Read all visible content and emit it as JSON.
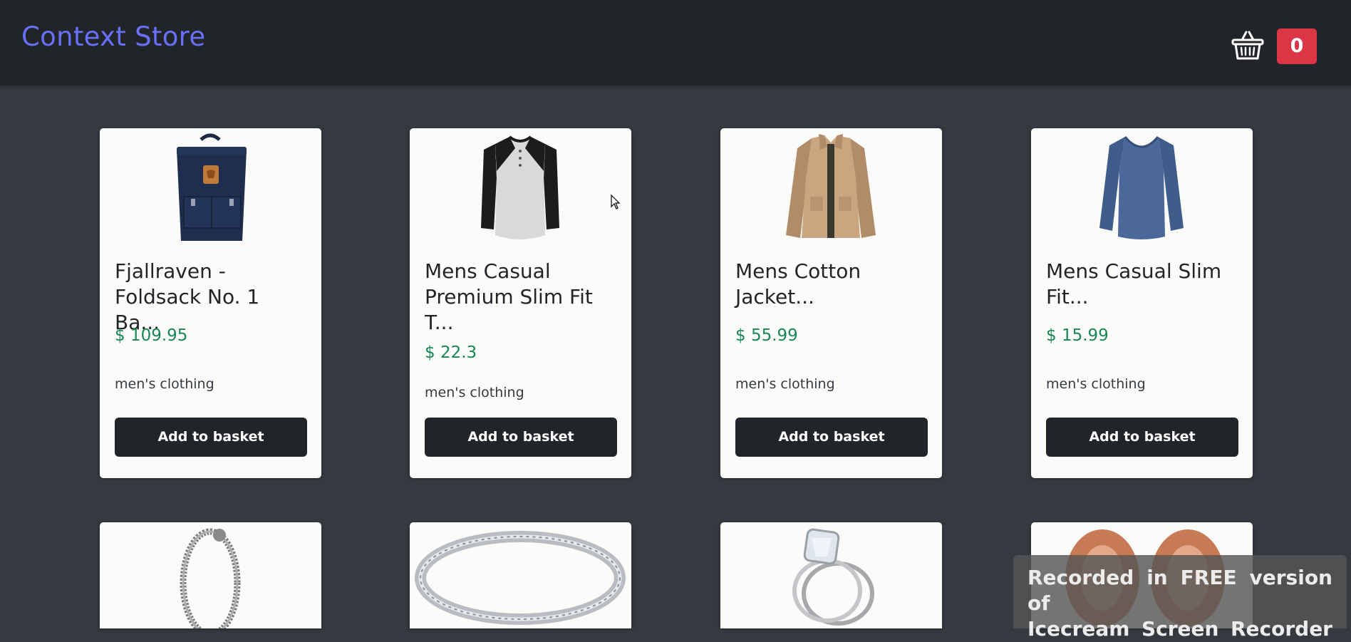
{
  "header": {
    "brand": "Context Store",
    "basket_icon": "basket-icon",
    "basket_count": "0"
  },
  "products": [
    {
      "title": "Fjallraven - Foldsack No. 1 Ba...",
      "price": "$ 109.95",
      "category": "men's clothing",
      "button": "Add to basket",
      "image": "backpack"
    },
    {
      "title": "Mens Casual Premium Slim Fit T...",
      "price": "$ 22.3",
      "category": "men's clothing",
      "button": "Add to basket",
      "image": "raglan-tshirt"
    },
    {
      "title": "Mens Cotton Jacket...",
      "price": "$ 55.99",
      "category": "men's clothing",
      "button": "Add to basket",
      "image": "jacket"
    },
    {
      "title": "Mens Casual Slim Fit...",
      "price": "$ 15.99",
      "category": "men's clothing",
      "button": "Add to basket",
      "image": "long-sleeve-tshirt"
    },
    {
      "image": "chain-bracelet"
    },
    {
      "image": "silver-ring"
    },
    {
      "image": "diamond-ring"
    },
    {
      "image": "rose-gold-earrings"
    }
  ],
  "watermark": {
    "line1": "Recorded in FREE version of",
    "line2": "Icecream Screen Recorder"
  },
  "colors": {
    "background": "#343a40",
    "navbar": "#212529",
    "brand": "#6a6ff7",
    "price": "#198754",
    "badge": "#dc3545"
  }
}
